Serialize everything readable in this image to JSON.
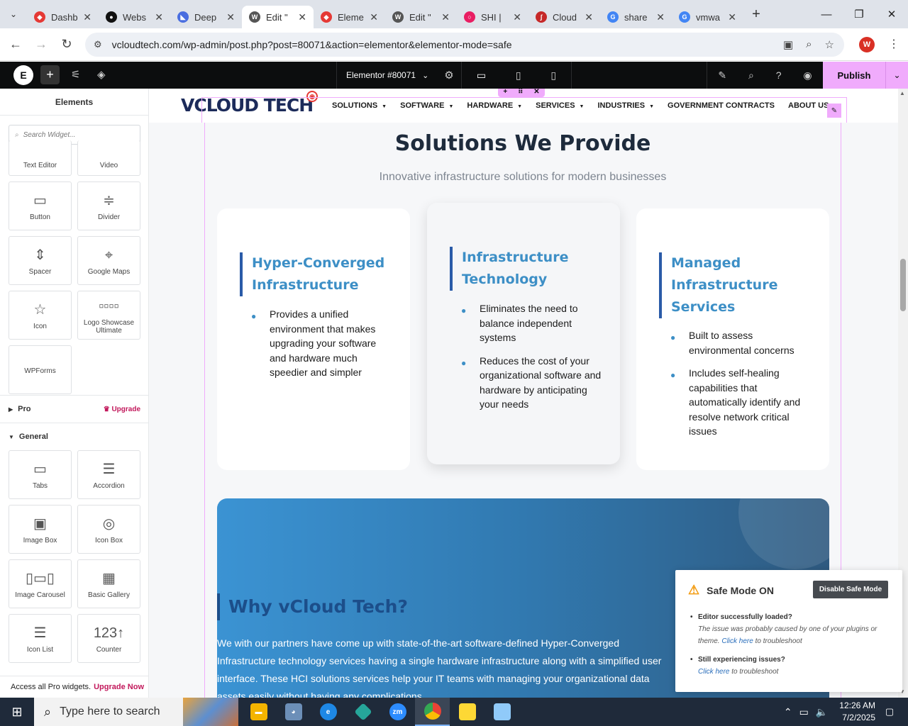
{
  "browser": {
    "tabs": [
      {
        "label": "Dashb",
        "color": "#e53935",
        "glyph": "◆",
        "active": false
      },
      {
        "label": "Webs",
        "color": "#111111",
        "glyph": "●",
        "active": false
      },
      {
        "label": "Deep",
        "color": "#4a6ee0",
        "glyph": "◣",
        "active": false
      },
      {
        "label": "Edit \"",
        "color": "#555555",
        "glyph": "W",
        "active": true
      },
      {
        "label": "Eleme",
        "color": "#e53935",
        "glyph": "◆",
        "active": false
      },
      {
        "label": "Edit \"",
        "color": "#555555",
        "glyph": "W",
        "active": false
      },
      {
        "label": "SHI | ",
        "color": "#e91e63",
        "glyph": "○",
        "active": false
      },
      {
        "label": "Cloud",
        "color": "#c62828",
        "glyph": "∫",
        "active": false
      },
      {
        "label": "share",
        "color": "#4285f4",
        "glyph": "G",
        "active": false
      },
      {
        "label": "vmwa",
        "color": "#4285f4",
        "glyph": "G",
        "active": false
      }
    ],
    "url": "vcloudtech.com/wp-admin/post.php?post=80071&action=elementor&elementor-mode=safe",
    "profile_initial": "W"
  },
  "editor": {
    "document_title": "Elementor #80071",
    "publish_label": "Publish"
  },
  "panel": {
    "title": "Elements",
    "search_placeholder": "Search Widget...",
    "basic_widgets": [
      {
        "label": "Text Editor",
        "icon": "text-editor-icon",
        "glyph": "▬"
      },
      {
        "label": "Video",
        "icon": "video-icon",
        "glyph": "▬"
      },
      {
        "label": "Button",
        "icon": "button-icon",
        "glyph": "▭"
      },
      {
        "label": "Divider",
        "icon": "divider-icon",
        "glyph": "≑"
      },
      {
        "label": "Spacer",
        "icon": "spacer-icon",
        "glyph": "⇕"
      },
      {
        "label": "Google Maps",
        "icon": "map-icon",
        "glyph": "⌖"
      },
      {
        "label": "Icon",
        "icon": "star-icon",
        "glyph": "☆"
      },
      {
        "label": "Logo Showcase Ultimate",
        "icon": "logo-showcase-icon",
        "glyph": "▫▫▫▫"
      },
      {
        "label": "WPForms",
        "icon": "",
        "glyph": ""
      }
    ],
    "pro_section": "Pro",
    "upgrade_label": "Upgrade",
    "general_section": "General",
    "general_widgets": [
      {
        "label": "Tabs",
        "icon": "tabs-icon",
        "glyph": "▭"
      },
      {
        "label": "Accordion",
        "icon": "accordion-icon",
        "glyph": "☰"
      },
      {
        "label": "Image Box",
        "icon": "image-box-icon",
        "glyph": "▣"
      },
      {
        "label": "Icon Box",
        "icon": "icon-box-icon",
        "glyph": "◎"
      },
      {
        "label": "Image Carousel",
        "icon": "image-carousel-icon",
        "glyph": "▯▭▯"
      },
      {
        "label": "Basic Gallery",
        "icon": "gallery-icon",
        "glyph": "▦"
      },
      {
        "label": "Icon List",
        "icon": "icon-list-icon",
        "glyph": "☰"
      },
      {
        "label": "Counter",
        "icon": "counter-icon",
        "glyph": "123↑"
      }
    ],
    "footer_text": "Access all Pro widgets.",
    "footer_link": "Upgrade Now"
  },
  "site": {
    "logo_main": "VCLOUD",
    "logo_accent": "TECH",
    "nav": [
      {
        "label": "SOLUTIONS",
        "dropdown": true
      },
      {
        "label": "SOFTWARE",
        "dropdown": true
      },
      {
        "label": "HARDWARE",
        "dropdown": true
      },
      {
        "label": "SERVICES",
        "dropdown": true
      },
      {
        "label": "INDUSTRIES",
        "dropdown": true
      },
      {
        "label": "GOVERNMENT CONTRACTS",
        "dropdown": false
      },
      {
        "label": "ABOUT US",
        "dropdown": false
      }
    ],
    "section_title": "Solutions We Provide",
    "section_subtitle": "Innovative infrastructure solutions for modern businesses",
    "cards": [
      {
        "title": "Hyper-Converged Infrastructure",
        "bullets": [
          "Provides a unified environment that makes upgrading your software and hardware much speedier and simpler"
        ]
      },
      {
        "title": "Infrastructure Technology",
        "bullets": [
          "Eliminates the need to balance independent systems",
          "Reduces the cost of your organizational software and hardware by anticipating your needs"
        ]
      },
      {
        "title": "Managed Infrastructure Services",
        "bullets": [
          "Built to assess environmental concerns",
          "Includes self-healing capabilities that automatically identify and resolve network critical issues"
        ]
      }
    ],
    "why_title": "Why vCloud Tech?",
    "why_text": "We with our partners have come up with state-of-the-art software-defined Hyper-Converged Infrastructure technology services having a single hardware infrastructure along with a simplified user interface. These HCI solutions services help your IT teams with managing your organizational data assets easily without having any complications."
  },
  "safe_mode": {
    "title": "Safe Mode ON",
    "button": "Disable Safe Mode",
    "q1": "Editor successfully loaded?",
    "a1_text": "The issue was probably caused by one of your plugins or theme.",
    "a1_link": "Click here",
    "a1_tail": "to troubleshoot",
    "q2": "Still experiencing issues?",
    "a2_link": "Click here",
    "a2_tail": "to troubleshoot"
  },
  "taskbar": {
    "search_placeholder": "Type here to search",
    "time": "12:26 AM",
    "date": "7/2/2025"
  }
}
